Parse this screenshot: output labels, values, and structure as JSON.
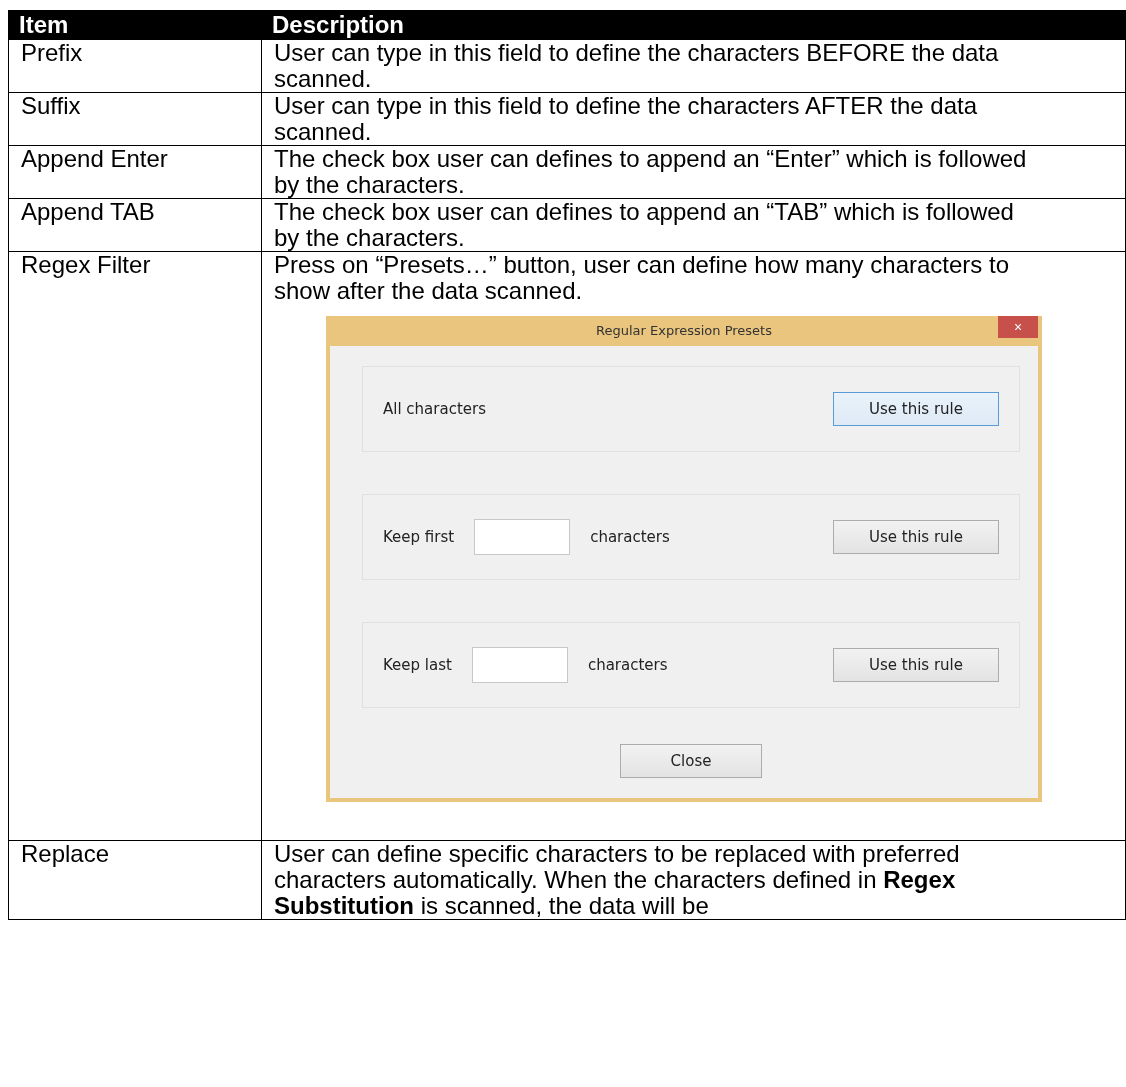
{
  "table": {
    "columns": [
      "Item",
      "Description"
    ],
    "rows": [
      {
        "item": "Prefix",
        "description": "User can type in this field to define the characters BEFORE the data scanned."
      },
      {
        "item": "Suffix",
        "description": "User can type in this field to define the characters AFTER the data scanned."
      },
      {
        "item": "Append Enter",
        "description": "The check box user can defines to append an “Enter” which is followed by the characters."
      },
      {
        "item": "Append TAB",
        "description": "The check box user can defines to append an “TAB” which is followed by the characters."
      },
      {
        "item": "Regex Filter",
        "description": "Press on “Presets…” button, user can define how many characters to show after the data scanned.",
        "dialog": {
          "title": "Regular Expression Presets",
          "close_icon": "×",
          "rules": [
            {
              "kind": "plain",
              "label": "All characters",
              "button": "Use this rule",
              "focused": true
            },
            {
              "kind": "input",
              "label": "Keep first",
              "suffix": "characters",
              "button": "Use this rule",
              "focused": false
            },
            {
              "kind": "input",
              "label": "Keep last",
              "suffix": "characters",
              "button": "Use this rule",
              "focused": false
            }
          ],
          "close_button": "Close"
        }
      },
      {
        "item": "Replace",
        "description": "User can define specific characters to be replaced with preferred characters automatically. When the characters defined in **Regex Substitution** is scanned, the data will be"
      }
    ]
  }
}
